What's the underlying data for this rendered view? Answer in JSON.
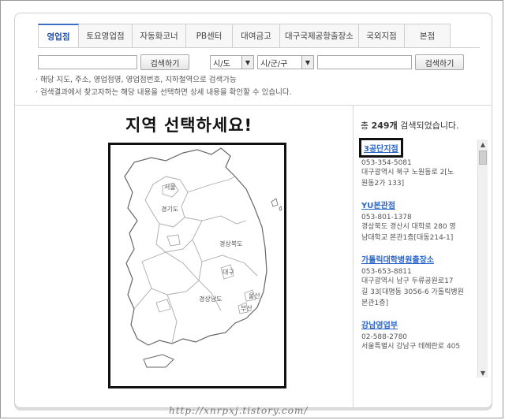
{
  "tabs": [
    "영업점",
    "토요영업점",
    "자동화코너",
    "PB센터",
    "대여금고",
    "대구국제공항출장소",
    "국외지점",
    "본점"
  ],
  "active_tab": "영업점",
  "search": {
    "button1": "검색하기",
    "sido_value": "시/도",
    "gungu_value": "시/군/구",
    "button2": "검색하기"
  },
  "notes": [
    "· 해당 지도, 주소, 영업점명, 영업점번호, 지하철역으로 검색가능",
    "· 검색결과에서 찾고자하는 해당 내용을 선택하면 상세 내용을 확인할 수 있습니다."
  ],
  "map": {
    "title": "지역 선택하세요!",
    "regions": {
      "seoul": "서울",
      "gyeonggi": "경기도",
      "gyeongbuk": "경상북도",
      "daegu": "대구",
      "ulsan": "울산",
      "gyeongnam": "경상남도",
      "busan": "부산"
    }
  },
  "results": {
    "prefix": "총 ",
    "count": "249개",
    "suffix": " 검색되었습니다.",
    "items": [
      {
        "name": "3공단지점",
        "phone": "053-354-5081",
        "addr1": "대구광역시 북구 노원동로 2[노",
        "addr2": "원동2가 133]"
      },
      {
        "name": "YU본관점",
        "phone": "053-801-1378",
        "addr1": "경상북도 경산시 대학로 280 영",
        "addr2": "남대학교 본관1층[대동214-1]"
      },
      {
        "name": "가톨릭대학병원출장소",
        "phone": "053-653-8811",
        "addr1": "대구광역시 남구 두류공원로17",
        "addr2": "길 33[대명동 3056-6 가톨릭병원",
        "addr3": "본관1층]"
      },
      {
        "name": "강남영업부",
        "phone": "02-588-2780",
        "addr1": "서울특별시 강남구 테헤란로 405"
      }
    ]
  },
  "watermark": "http://xnrpxj.tistory.com/"
}
